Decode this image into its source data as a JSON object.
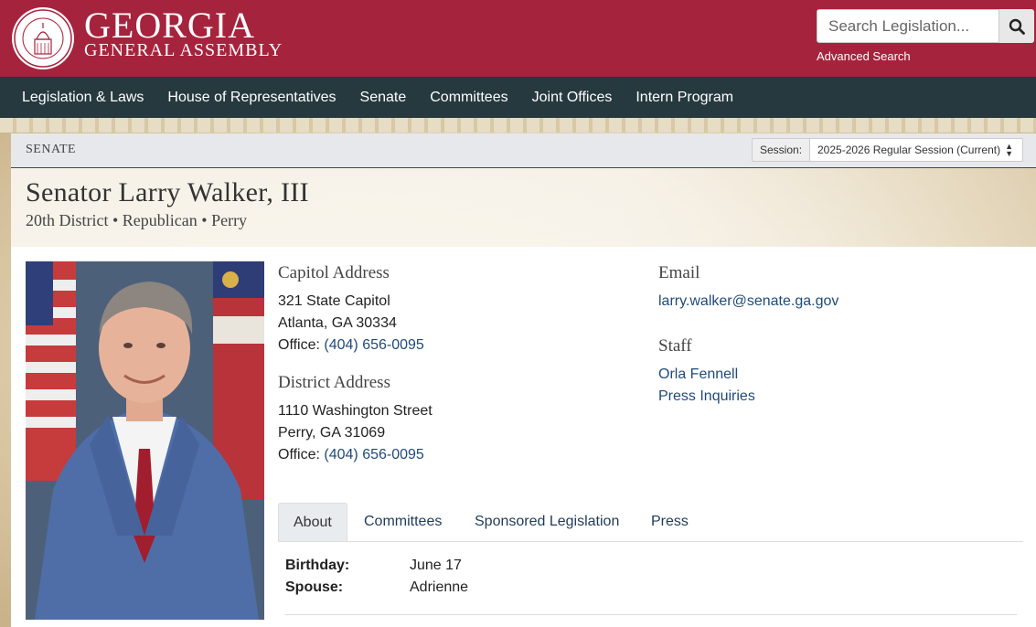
{
  "header": {
    "brand_line1": "GEORGIA",
    "brand_line2": "GENERAL ASSEMBLY",
    "search_placeholder": "Search Legislation...",
    "advanced_search": "Advanced Search",
    "colors": {
      "header_bg": "#a6233d",
      "nav_bg": "#26393f",
      "link": "#1f4a7a"
    }
  },
  "nav": {
    "items": [
      "Legislation & Laws",
      "House of Representatives",
      "Senate",
      "Committees",
      "Joint Offices",
      "Intern Program"
    ]
  },
  "breadcrumb": {
    "current": "SENATE",
    "session_label": "Session:",
    "session_value": "2025-2026 Regular Session (Current)"
  },
  "senator": {
    "name": "Senator Larry Walker, III",
    "subtitle": "20th District • Republican • Perry"
  },
  "capitol": {
    "heading": "Capitol Address",
    "line1": "321 State Capitol",
    "line2": "Atlanta, GA 30334",
    "office_label": "Office: ",
    "office_phone": "(404) 656-0095"
  },
  "district": {
    "heading": "District Address",
    "line1": "1110 Washington Street",
    "line2": "Perry, GA 31069",
    "office_label": "Office: ",
    "office_phone": "(404) 656-0095"
  },
  "email": {
    "heading": "Email",
    "address": "larry.walker@senate.ga.gov"
  },
  "staff": {
    "heading": "Staff",
    "items": [
      "Orla Fennell",
      "Press Inquiries"
    ]
  },
  "tabs": [
    "About",
    "Committees",
    "Sponsored Legislation",
    "Press"
  ],
  "about": {
    "birthday_label": "Birthday:",
    "birthday": "June 17",
    "spouse_label": "Spouse:",
    "spouse": "Adrienne"
  }
}
